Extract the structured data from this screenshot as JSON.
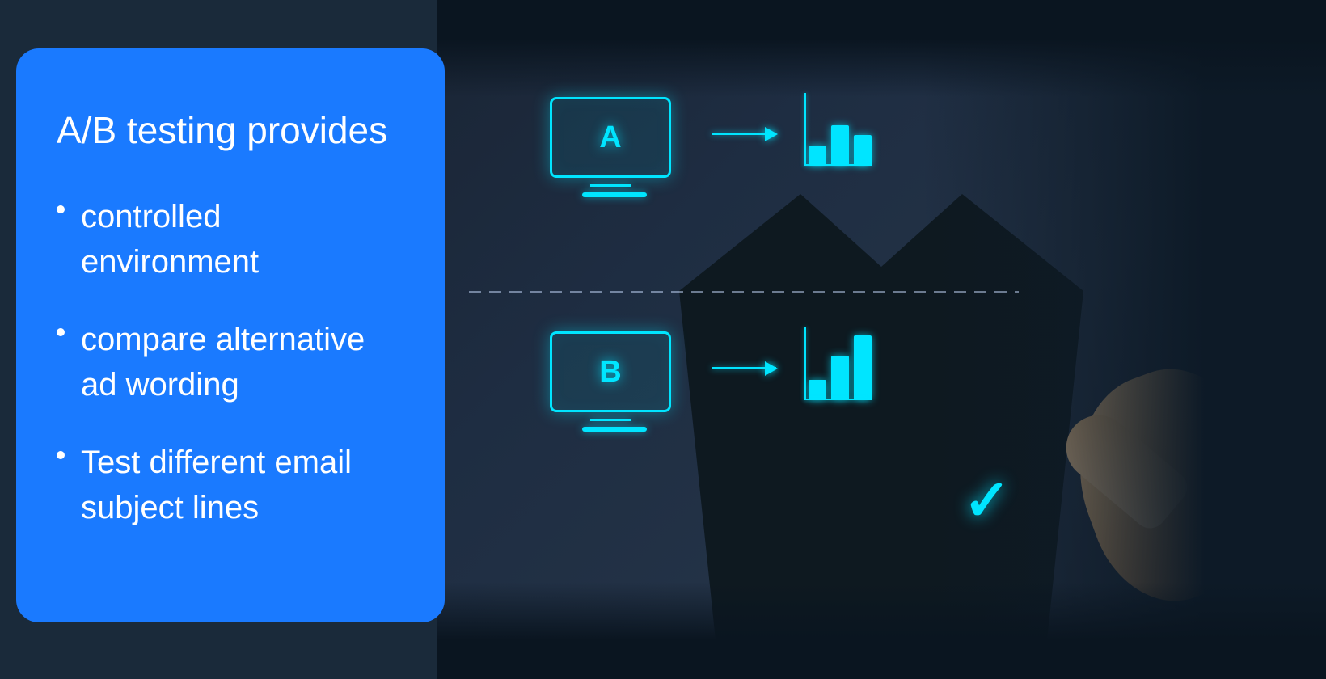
{
  "card": {
    "title": "A/B testing provides",
    "bullets": [
      {
        "text_line1": "controlled",
        "text_line2": "environment"
      },
      {
        "text_line1": "compare alternative",
        "text_line2": "ad wording"
      },
      {
        "text_line1": "Test different email",
        "text_line2": "subject lines"
      }
    ]
  },
  "diagram": {
    "version_a_label": "A",
    "version_b_label": "B",
    "bars_a": [
      25,
      50,
      38
    ],
    "bars_b": [
      25,
      55,
      80
    ]
  },
  "colors": {
    "card_bg": "#1a7aff",
    "card_text": "#ffffff",
    "diagram_cyan": "#00e5ff",
    "bg_dark": "#0f1a28"
  }
}
